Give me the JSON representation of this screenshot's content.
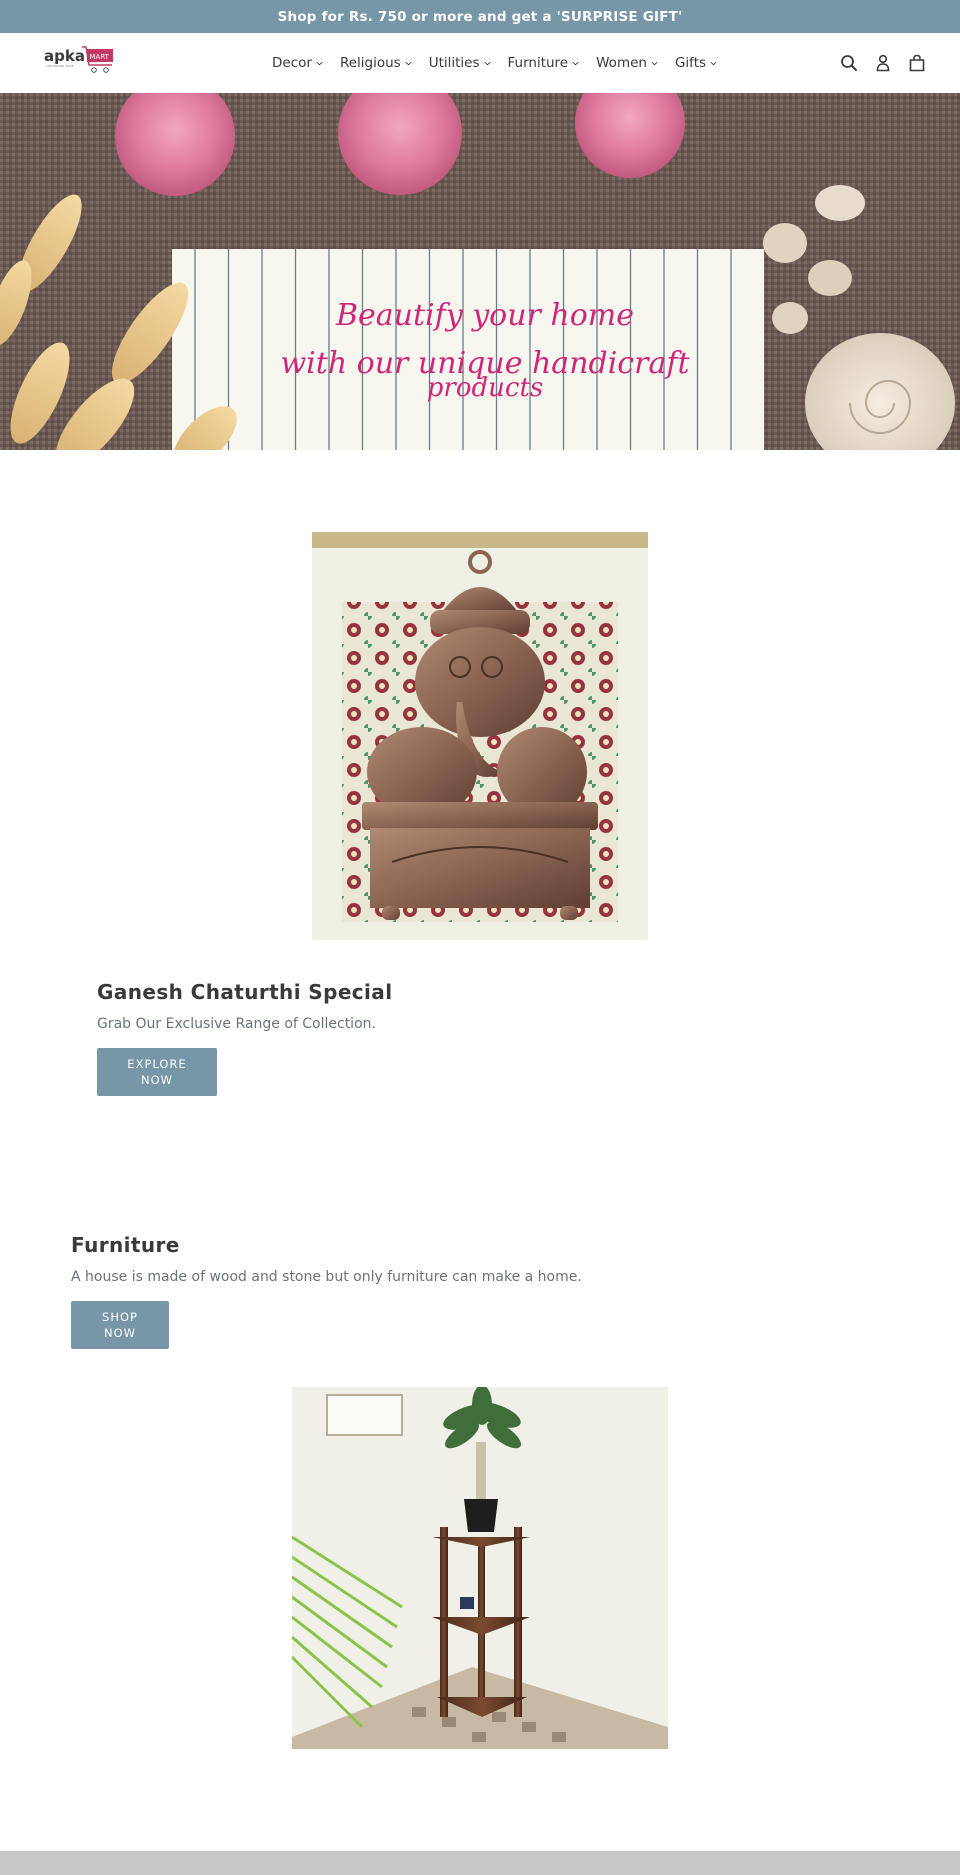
{
  "announcement": {
    "text": "Shop for Rs. 750 or more and get a 'SURPRISE GIFT'"
  },
  "header": {
    "logo": {
      "primary": "apka",
      "badge": "MART",
      "tagline": "THE ONLINE SHOP"
    },
    "nav": [
      {
        "label": "Decor",
        "icon": "chevron-down-icon"
      },
      {
        "label": "Religious",
        "icon": "chevron-down-icon"
      },
      {
        "label": "Utilities",
        "icon": "chevron-down-icon"
      },
      {
        "label": "Furniture",
        "icon": "chevron-down-icon"
      },
      {
        "label": "Women",
        "icon": "chevron-down-icon"
      },
      {
        "label": "Gifts",
        "icon": "chevron-down-icon"
      }
    ],
    "icons": [
      "search-icon",
      "account-icon",
      "cart-icon"
    ]
  },
  "hero": {
    "line1": "Beautify your home",
    "line2": "with our unique handicraft",
    "line3": "products",
    "text_color": "#d0267a"
  },
  "feature": {
    "image_alt": "Copper Ganesha idol writing at a desk",
    "title": "Ganesh Chaturthi Special",
    "subtitle": "Grab Our Exclusive Range of Collection.",
    "button_line1": "EXPLORE",
    "button_line2": "NOW"
  },
  "furniture": {
    "title": "Furniture",
    "subtitle": "A house is made of wood and stone but only furniture can make a home.",
    "button_line1": "SHOP",
    "button_line2": "NOW",
    "image_alt": "Wooden corner shelf stand with potted plant"
  },
  "colors": {
    "accent": "#7796a8",
    "text_dark": "#3a3a3a",
    "text_muted": "#69727b",
    "logo_pink": "#c23a63",
    "footer": "#c8c9cb"
  }
}
